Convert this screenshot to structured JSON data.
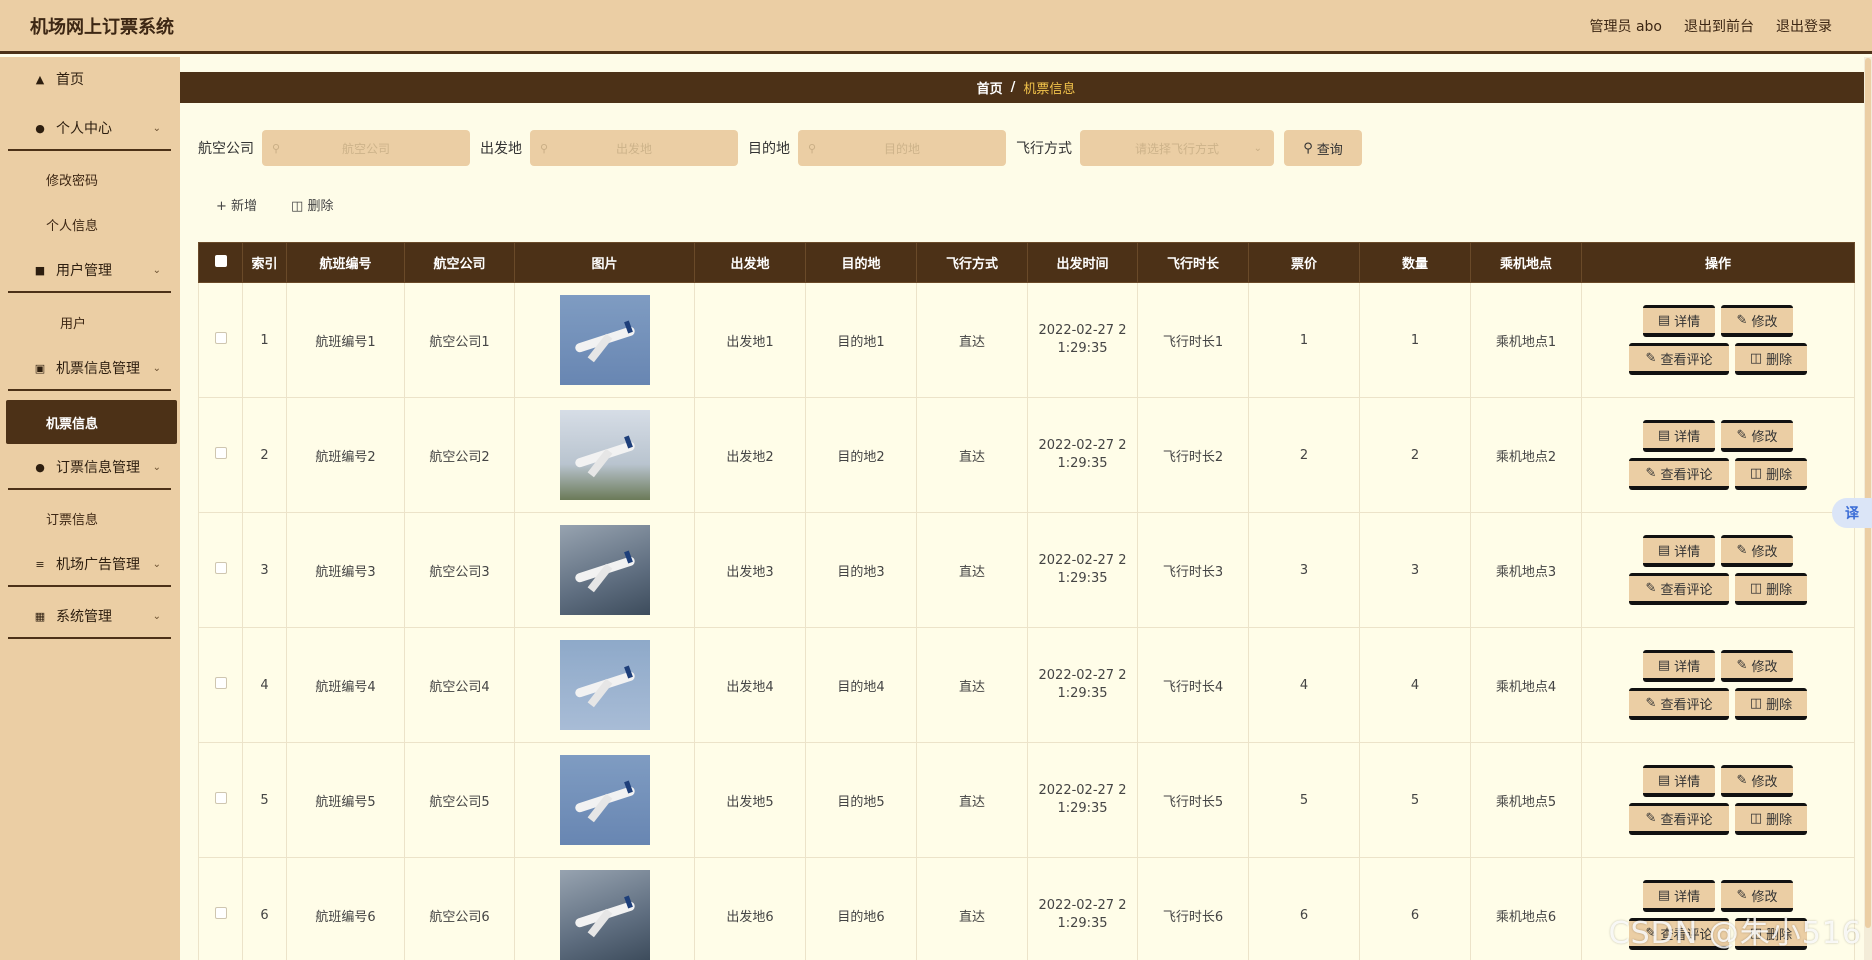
{
  "header": {
    "title": "机场网上订票系统",
    "links": [
      "管理员 abo",
      "退出到前台",
      "退出登录"
    ]
  },
  "sidebar": {
    "home": "首页",
    "personal": "个人中心",
    "change_password": "修改密码",
    "profile": "个人信息",
    "user_mgmt": "用户管理",
    "user": "用户",
    "ticket_mgmt": "机票信息管理",
    "ticket_info": "机票信息",
    "booking_mgmt": "订票信息管理",
    "booking_info": "订票信息",
    "ad_mgmt": "机场广告管理",
    "system_mgmt": "系统管理"
  },
  "breadcrumb": {
    "home": "首页",
    "sep": "/",
    "current": "机票信息"
  },
  "search": {
    "airline_label": "航空公司",
    "airline_placeholder": "航空公司",
    "from_label": "出发地",
    "from_placeholder": "出发地",
    "to_label": "目的地",
    "to_placeholder": "目的地",
    "mode_label": "飞行方式",
    "mode_placeholder": "请选择飞行方式",
    "query_label": "查询"
  },
  "toolbar": {
    "add_label": "新增",
    "delete_label": "删除"
  },
  "table": {
    "headers": [
      "索引",
      "航班编号",
      "航空公司",
      "图片",
      "出发地",
      "目的地",
      "飞行方式",
      "出发时间",
      "飞行时长",
      "票价",
      "数量",
      "乘机地点",
      "操作"
    ],
    "rows": [
      {
        "index": "1",
        "flight": "航班编号1",
        "airline": "航空公司1",
        "from": "出发地1",
        "to": "目的地1",
        "mode": "直达",
        "time": "2022-02-27 21:29:35",
        "duration": "飞行时长1",
        "price": "1",
        "qty": "1",
        "place": "乘机地点1"
      },
      {
        "index": "2",
        "flight": "航班编号2",
        "airline": "航空公司2",
        "from": "出发地2",
        "to": "目的地2",
        "mode": "直达",
        "time": "2022-02-27 21:29:35",
        "duration": "飞行时长2",
        "price": "2",
        "qty": "2",
        "place": "乘机地点2"
      },
      {
        "index": "3",
        "flight": "航班编号3",
        "airline": "航空公司3",
        "from": "出发地3",
        "to": "目的地3",
        "mode": "直达",
        "time": "2022-02-27 21:29:35",
        "duration": "飞行时长3",
        "price": "3",
        "qty": "3",
        "place": "乘机地点3"
      },
      {
        "index": "4",
        "flight": "航班编号4",
        "airline": "航空公司4",
        "from": "出发地4",
        "to": "目的地4",
        "mode": "直达",
        "time": "2022-02-27 21:29:35",
        "duration": "飞行时长4",
        "price": "4",
        "qty": "4",
        "place": "乘机地点4"
      },
      {
        "index": "5",
        "flight": "航班编号5",
        "airline": "航空公司5",
        "from": "出发地5",
        "to": "目的地5",
        "mode": "直达",
        "time": "2022-02-27 21:29:35",
        "duration": "飞行时长5",
        "price": "5",
        "qty": "5",
        "place": "乘机地点5"
      },
      {
        "index": "6",
        "flight": "航班编号6",
        "airline": "航空公司6",
        "from": "出发地6",
        "to": "目的地6",
        "mode": "直达",
        "time": "2022-02-27 21:29:35",
        "duration": "飞行时长6",
        "price": "6",
        "qty": "6",
        "place": "乘机地点6"
      }
    ],
    "ops": {
      "detail": "详情",
      "edit": "修改",
      "comments": "查看评论",
      "delete": "删除"
    }
  },
  "translate_label": "译",
  "watermark": "CSDN @朱小516",
  "colors": {
    "accent_dark": "#4c3117",
    "accent_light": "#ebcea4",
    "page_bg": "#fefce8"
  }
}
